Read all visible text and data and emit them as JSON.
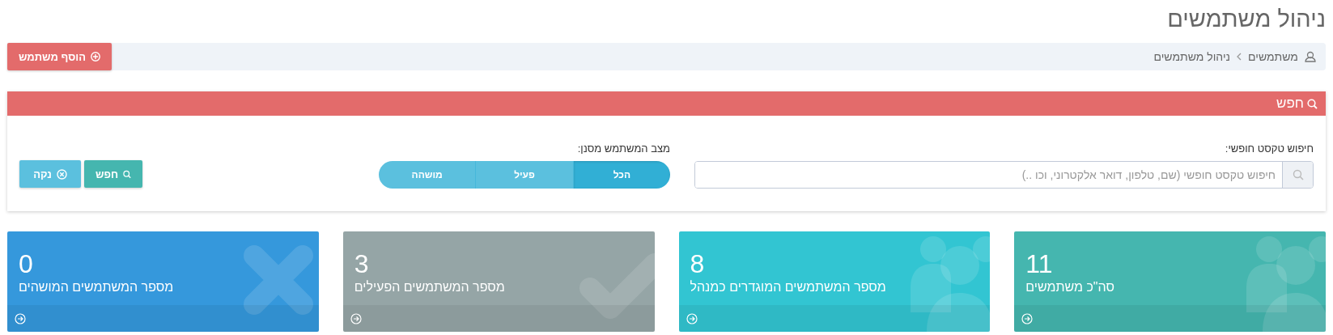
{
  "page_title": "ניהול משתמשים",
  "breadcrumb": [
    "משתמשים",
    "ניהול משתמשים"
  ],
  "add_button": "הוסף משתמש",
  "search_panel": {
    "title": "חפש",
    "free_text": {
      "label": "חיפוש טקסט חופשי:",
      "placeholder": "חיפוש טקסט חופשי (שם, טלפון, דואר אלקטרוני, וכו ..)"
    },
    "status_filter": {
      "label": "מצב המשתמש מסנן:",
      "options": [
        {
          "label": "הכל",
          "selected": true
        },
        {
          "label": "פעיל",
          "selected": false
        },
        {
          "label": "מושהה",
          "selected": false
        }
      ]
    },
    "buttons": [
      {
        "kind": "search",
        "label": "חפש"
      },
      {
        "kind": "clear",
        "label": "נקה"
      }
    ]
  },
  "stat_cards": [
    {
      "kind": "users",
      "count": "11",
      "label": "סה\"כ משתמשים",
      "color": "#45b6af"
    },
    {
      "kind": "users",
      "count": "8",
      "label": "מספר המשתמשים המוגדרים כמנהל",
      "color": "#32c5d2"
    },
    {
      "kind": "check",
      "count": "3",
      "label": "מספר המשתמשים הפעילים",
      "color": "#95a5a6"
    },
    {
      "kind": "x",
      "count": "0",
      "label": "מספר המשתמשים המושהים",
      "color": "#3598dc"
    }
  ]
}
